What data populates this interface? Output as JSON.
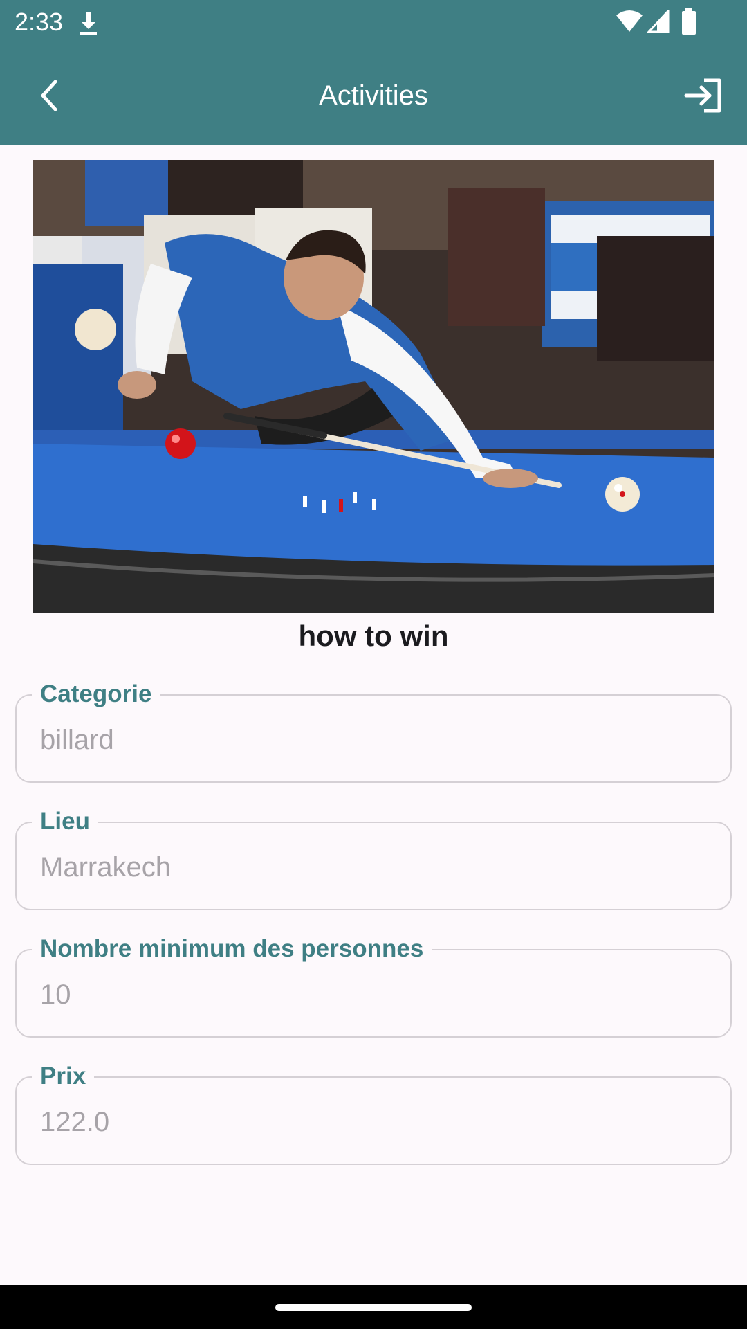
{
  "status_bar": {
    "time": "2:33",
    "icons": [
      "download-icon",
      "wifi-icon",
      "cellular-signal-icon",
      "battery-icon"
    ]
  },
  "app_bar": {
    "title": "Activities",
    "back_icon": "chevron-left-icon",
    "login_icon": "login-icon"
  },
  "activity": {
    "title": "how to win",
    "image": "billiards-player-photo",
    "fields": [
      {
        "label": "Categorie",
        "value": "billard"
      },
      {
        "label": "Lieu",
        "value": "Marrakech"
      },
      {
        "label": "Nombre minimum des personnes",
        "value": "10"
      },
      {
        "label": "Prix",
        "value": "122.0"
      }
    ]
  },
  "colors": {
    "primary": "#3f7f84",
    "background": "#fdf9fc",
    "field_border": "#d5d0d5",
    "field_value": "#a7a3a8",
    "title_text": "#1b1b1f",
    "nav_bar": "#000000"
  }
}
